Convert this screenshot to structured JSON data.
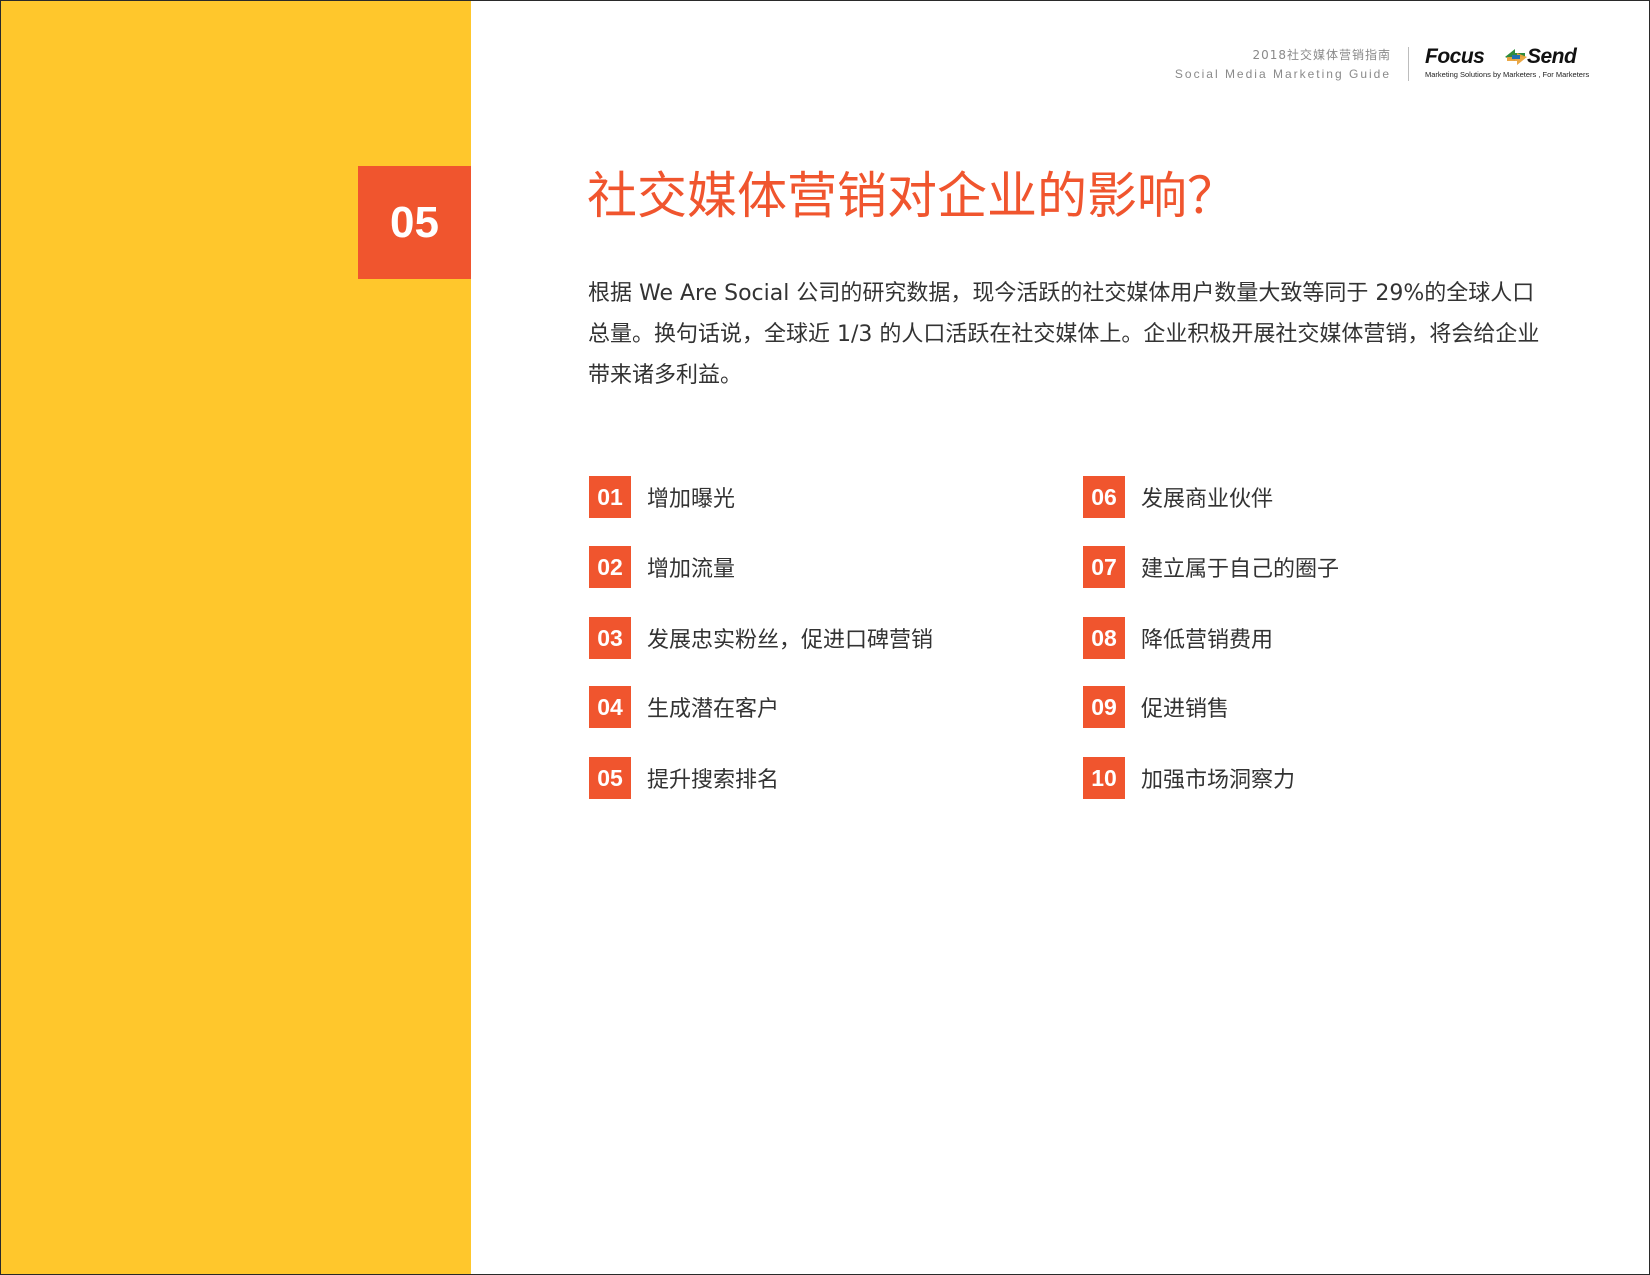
{
  "header": {
    "guide_title_cn": "2018社交媒体营销指南",
    "guide_title_en": "Social Media Marketing Guide",
    "logo": {
      "word_left": "Focus",
      "word_right": "Send",
      "tagline": "Marketing Solutions by Marketers , For Marketers"
    }
  },
  "section": {
    "number": "05",
    "title": "社交媒体营销对企业的影响？",
    "intro": "根据 We Are Social 公司的研究数据，现今活跃的社交媒体用户数量大致等同于 29%的全球人口总量。换句话说，全球近 1/3 的人口活跃在社交媒体上。企业积极开展社交媒体营销，将会给企业带来诸多利益。"
  },
  "benefits": [
    {
      "num": "01",
      "label": "增加曝光"
    },
    {
      "num": "02",
      "label": "增加流量"
    },
    {
      "num": "03",
      "label": "发展忠实粉丝，促进口碑营销"
    },
    {
      "num": "04",
      "label": "生成潜在客户"
    },
    {
      "num": "05",
      "label": "提升搜索排名"
    },
    {
      "num": "06",
      "label": "发展商业伙伴"
    },
    {
      "num": "07",
      "label": "建立属于自己的圈子"
    },
    {
      "num": "08",
      "label": "降低营销费用"
    },
    {
      "num": "09",
      "label": "促进销售"
    },
    {
      "num": "10",
      "label": "加强市场洞察力"
    }
  ],
  "colors": {
    "accent": "#F0552E",
    "band": "#FFC72C",
    "text": "#333333"
  }
}
